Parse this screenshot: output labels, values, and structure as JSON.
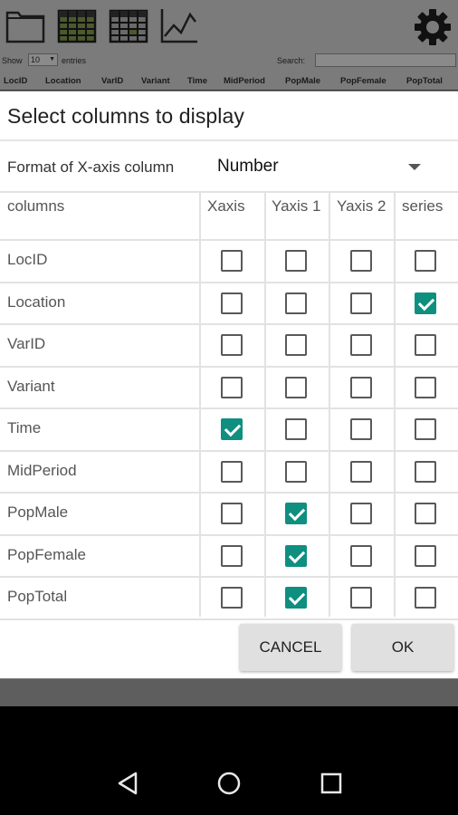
{
  "toolbar": {
    "icons": [
      "folder-icon",
      "table-icon",
      "table-icon",
      "line-chart-icon",
      "gear-icon"
    ]
  },
  "datatable": {
    "show_label": "Show",
    "show_value": "10",
    "entries_label": "entries",
    "search_label": "Search:",
    "headers": [
      "LocID",
      "Location",
      "VarID",
      "Variant",
      "Time",
      "MidPeriod",
      "PopMale",
      "PopFemale",
      "PopTotal"
    ]
  },
  "dialog": {
    "title": "Select columns to display",
    "format_label": "Format of X-axis column",
    "format_value": "Number",
    "columns_header": "columns",
    "col_xaxis": "Xaxis",
    "col_yaxis1": "Yaxis 1",
    "col_yaxis2": "Yaxis 2",
    "col_series": "series",
    "rows": [
      {
        "name": "LocID",
        "xaxis": false,
        "yaxis1": false,
        "yaxis2": false,
        "series": false
      },
      {
        "name": "Location",
        "xaxis": false,
        "yaxis1": false,
        "yaxis2": false,
        "series": true
      },
      {
        "name": "VarID",
        "xaxis": false,
        "yaxis1": false,
        "yaxis2": false,
        "series": false
      },
      {
        "name": "Variant",
        "xaxis": false,
        "yaxis1": false,
        "yaxis2": false,
        "series": false
      },
      {
        "name": "Time",
        "xaxis": true,
        "yaxis1": false,
        "yaxis2": false,
        "series": false
      },
      {
        "name": "MidPeriod",
        "xaxis": false,
        "yaxis1": false,
        "yaxis2": false,
        "series": false
      },
      {
        "name": "PopMale",
        "xaxis": false,
        "yaxis1": true,
        "yaxis2": false,
        "series": false
      },
      {
        "name": "PopFemale",
        "xaxis": false,
        "yaxis1": true,
        "yaxis2": false,
        "series": false
      },
      {
        "name": "PopTotal",
        "xaxis": false,
        "yaxis1": true,
        "yaxis2": false,
        "series": false
      }
    ],
    "cancel_label": "CANCEL",
    "ok_label": "OK"
  },
  "colors": {
    "accent": "#0e8f80",
    "overlay": "#7b7b7b"
  },
  "navbar": {
    "icons": [
      "back-icon",
      "home-icon",
      "recents-icon"
    ]
  }
}
